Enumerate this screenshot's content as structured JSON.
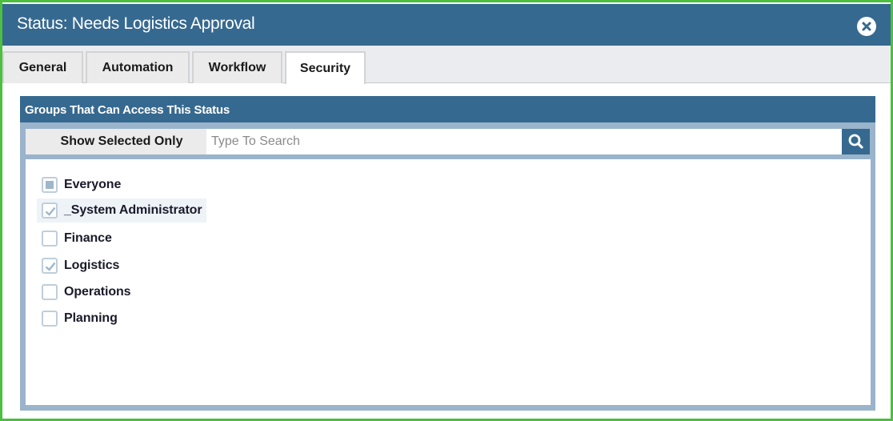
{
  "dialog": {
    "title": "Status: Needs Logistics Approval",
    "close_icon": "close-circle-icon"
  },
  "tabs": [
    {
      "label": "General",
      "active": false
    },
    {
      "label": "Automation",
      "active": false
    },
    {
      "label": "Workflow",
      "active": false
    },
    {
      "label": "Security",
      "active": true
    }
  ],
  "panel": {
    "header": "Groups That Can Access This Status",
    "show_selected_label": "Show Selected Only",
    "search": {
      "value": "",
      "placeholder": "Type To Search",
      "icon": "search-icon"
    },
    "groups": [
      {
        "label": "Everyone",
        "state": "partial"
      },
      {
        "label": "_System Administrator",
        "state": "checked"
      },
      {
        "label": "Finance",
        "state": "unchecked"
      },
      {
        "label": "Logistics",
        "state": "checked"
      },
      {
        "label": "Operations",
        "state": "unchecked"
      },
      {
        "label": "Planning",
        "state": "unchecked"
      }
    ]
  },
  "colors": {
    "header_blue": "#36698f",
    "panel_border": "#9ab4cb",
    "frame_green": "#4cbf3f"
  }
}
